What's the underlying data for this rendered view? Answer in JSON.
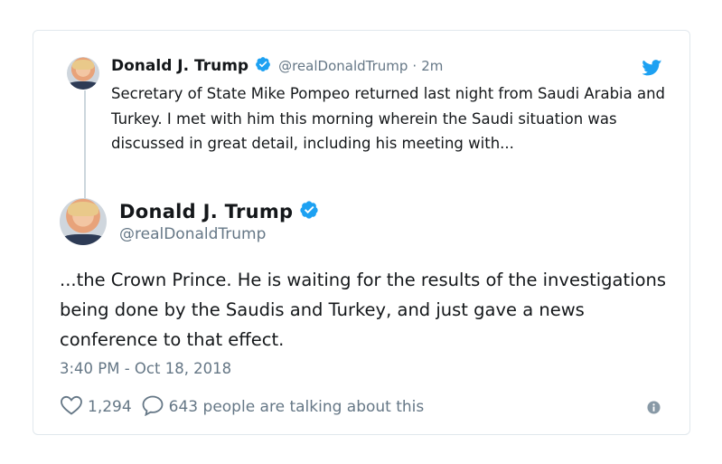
{
  "parent_tweet": {
    "author_name": "Donald J. Trump",
    "handle": "@realDonaldTrump",
    "separator": "·",
    "time": "2m",
    "text": "Secretary of State Mike Pompeo returned last night from Saudi Arabia and Turkey. I met with him this morning wherein the Saudi situation was discussed in great detail, including his meeting with..."
  },
  "main_tweet": {
    "author_name": "Donald J. Trump",
    "handle": "@realDonaldTrump",
    "text": "...the Crown Prince. He is waiting for the results of the investigations being done by the Saudis and Turkey, and just gave a news conference to that effect.",
    "timestamp": "3:40 PM - Oct 18, 2018"
  },
  "actions": {
    "likes": "1,294",
    "talking": "643 people are talking about this"
  },
  "colors": {
    "brand_blue": "#1da1f2",
    "secondary_text": "#657786",
    "border": "#e1e8ed"
  },
  "icons": [
    "verified-badge-icon",
    "twitter-bird-icon",
    "heart-icon",
    "reply-bubble-icon",
    "info-icon"
  ]
}
